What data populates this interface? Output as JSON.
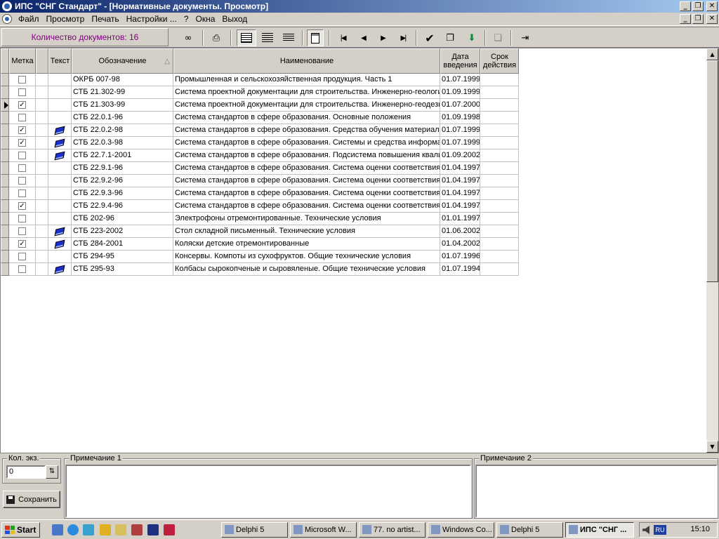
{
  "window": {
    "title": "ИПС \"СНГ Стандарт\" - [Нормативные документы. Просмотр]"
  },
  "menu": [
    "Файл",
    "Просмотр",
    "Печать",
    "Настройки ...",
    "?",
    "Окна",
    "Выход"
  ],
  "toolbar": {
    "doc_count": "Количество документов: 16",
    "buttons": [
      "glasses-icon",
      "printer-icon",
      "grid-view-icon",
      "list-view-icon",
      "text-view-icon",
      "clipboard-icon",
      "first-record-icon",
      "prev-record-icon",
      "next-record-icon",
      "last-record-icon",
      "checkmark-icon",
      "copy-icon",
      "export-icon",
      "book-icon",
      "exit-icon"
    ]
  },
  "grid": {
    "columns": {
      "mark": "Метка",
      "text": "Текст",
      "code": "Обозначение",
      "name": "Наименование",
      "date_line1": "Дата",
      "date_line2": "введения",
      "term_line1": "Срок",
      "term_line2": "действия"
    },
    "current_row": 2,
    "rows": [
      {
        "checked": false,
        "has_text": false,
        "code": "ОКРБ 007-98",
        "name": "Промышленная и сельскохозяйственная продукция. Часть 1",
        "date": "01.07.1999",
        "term": ""
      },
      {
        "checked": false,
        "has_text": false,
        "code": "СТБ 21.302-99",
        "name": "Система проектной документации для строительства. Инженерно-геологические",
        "date": "01.09.1999",
        "term": ""
      },
      {
        "checked": true,
        "has_text": false,
        "code": "СТБ 21.303-99",
        "name": "Система проектной документации для строительства. Инженерно-геодезические",
        "date": "01.07.2000",
        "term": ""
      },
      {
        "checked": false,
        "has_text": false,
        "code": "СТБ 22.0.1-96",
        "name": "Система стандартов в сфере образования. Основные положения",
        "date": "01.09.1998",
        "term": ""
      },
      {
        "checked": true,
        "has_text": true,
        "code": "СТБ 22.0.2-98",
        "name": "Система стандартов в сфере образования. Средства обучения материальные",
        "date": "01.07.1999",
        "term": ""
      },
      {
        "checked": true,
        "has_text": true,
        "code": "СТБ 22.0.3-98",
        "name": "Система стандартов в сфере образования. Системы и средства информационные",
        "date": "01.07.1999",
        "term": ""
      },
      {
        "checked": false,
        "has_text": true,
        "code": "СТБ 22.7.1-2001",
        "name": "Система стандартов в сфере образования. Подсистема повышения квалификации",
        "date": "01.09.2002",
        "term": ""
      },
      {
        "checked": false,
        "has_text": false,
        "code": "СТБ 22.9.1-96",
        "name": "Система стандартов в сфере образования. Система оценки соответствия",
        "date": "01.04.1997",
        "term": ""
      },
      {
        "checked": false,
        "has_text": false,
        "code": "СТБ 22.9.2-96",
        "name": "Система стандартов в сфере образования. Система оценки соответствия",
        "date": "01.04.1997",
        "term": ""
      },
      {
        "checked": false,
        "has_text": false,
        "code": "СТБ 22.9.3-96",
        "name": "Система стандартов в сфере образования. Система оценки соответствия",
        "date": "01.04.1997",
        "term": ""
      },
      {
        "checked": true,
        "has_text": false,
        "code": "СТБ 22.9.4-96",
        "name": "Система стандартов в сфере образования. Система оценки соответствия",
        "date": "01.04.1997",
        "term": ""
      },
      {
        "checked": false,
        "has_text": false,
        "code": "СТБ 202-96",
        "name": "Электрофоны отремонтированные. Технические условия",
        "date": "01.01.1997",
        "term": ""
      },
      {
        "checked": false,
        "has_text": true,
        "code": "СТБ 223-2002",
        "name": "Стол складной письменный. Технические условия",
        "date": "01.06.2002",
        "term": ""
      },
      {
        "checked": true,
        "has_text": true,
        "code": "СТБ 284-2001",
        "name": "Коляски детские отремонтированные",
        "date": "01.04.2002",
        "term": ""
      },
      {
        "checked": false,
        "has_text": false,
        "code": "СТБ 294-95",
        "name": "Консервы. Компоты из сухофруктов. Общие технические условия",
        "date": "01.07.1996",
        "term": ""
      },
      {
        "checked": false,
        "has_text": true,
        "code": "СТБ 295-93",
        "name": "Колбасы сырокопченые и сыровяленые. Общие технические условия",
        "date": "01.07.1994",
        "term": ""
      }
    ]
  },
  "bottom": {
    "qty_label": "Кол. экз.",
    "qty_value": "0",
    "save_label": "Сохранить",
    "note1_label": "Примечание 1",
    "note2_label": "Примечание 2"
  },
  "taskbar": {
    "start_label": "Start",
    "tasks": [
      "Delphi 5",
      "Microsoft W...",
      "77. no artist...",
      "Windows Co...",
      "Delphi 5",
      "ИПС \"СНГ ..."
    ],
    "active_task": 5,
    "lang": "RU",
    "clock": "15:10"
  }
}
